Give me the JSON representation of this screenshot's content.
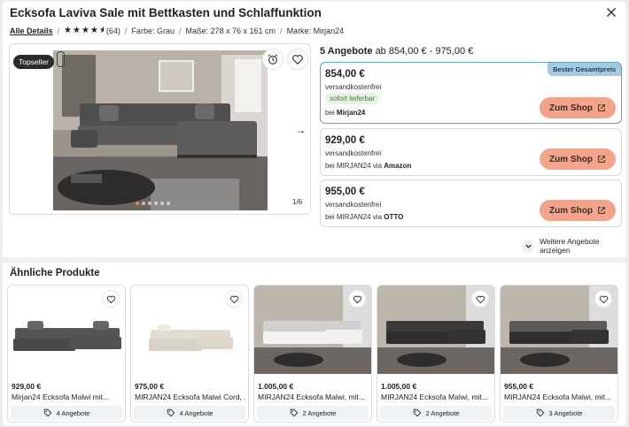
{
  "header": {
    "title": "Ecksofa Laviva Sale mit Bettkasten und Schlaffunktion",
    "details_link": "Alle Details",
    "rating_count": "(64)",
    "rating_value": 4.5,
    "color": "Farbe: Grau",
    "dimensions": "Maße: 278 x 76 x 161 cm",
    "brand": "Marke: Mirjan24"
  },
  "gallery": {
    "badge": "Topseller",
    "counter": "1/6",
    "active_index": 0,
    "total": 6
  },
  "offers": {
    "count_label": "5 Angebote",
    "range_label": "ab 854,00 € - 975,00 €",
    "items": [
      {
        "price": "854,00 €",
        "shipping": "versandkostenfrei",
        "stock": "sofort lieferbar",
        "seller_prefix": "bei ",
        "seller": "Mirjan24",
        "via": "",
        "badge": "Bester Gesamtpreis",
        "button": "Zum Shop"
      },
      {
        "price": "929,00 €",
        "shipping": "versandkostenfrei",
        "seller_prefix": "bei MIRJAN24 via ",
        "seller": "Amazon",
        "button": "Zum Shop"
      },
      {
        "price": "955,00 €",
        "shipping": "versandkostenfrei",
        "seller_prefix": "bei MIRJAN24 via ",
        "seller": "OTTO",
        "button": "Zum Shop"
      }
    ],
    "more_label": "Weitere Angebote anzeigen"
  },
  "similar": {
    "title": "Ähnliche Produkte",
    "cards": [
      {
        "price": "929,00 €",
        "name": "Mirjan24 Ecksofa Malwi mit...",
        "offers": "4 Angebote"
      },
      {
        "price": "975,00 €",
        "name": "MIRJAN24 Ecksofa Malwi Cord, ...",
        "offers": "4 Angebote"
      },
      {
        "price": "1.005,00 €",
        "name": "MIRJAN24 Ecksofa Malwi, mit...",
        "offers": "2 Angebote"
      },
      {
        "price": "1.005,00 €",
        "name": "MIRJAN24 Ecksofa Malwi, mit...",
        "offers": "2 Angebote"
      },
      {
        "price": "955,00 €",
        "name": "MIRJAN24 Ecksofa Malwi, mit...",
        "offers": "3 Angebote"
      }
    ]
  },
  "colors": {
    "accent_button": "#f4a48a",
    "best_badge": "#a7c8de",
    "in_stock": "#3e7b37"
  }
}
